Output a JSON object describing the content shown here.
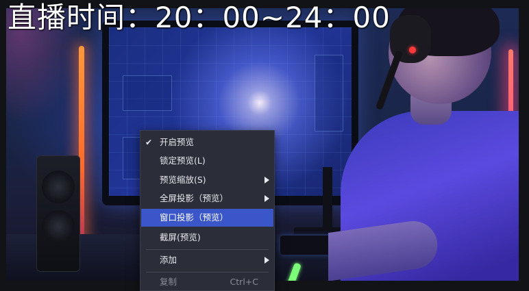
{
  "overlay": {
    "title": "直播时间：20：00~24：00"
  },
  "context_menu": {
    "items": [
      {
        "label": "开启预览",
        "checked": true
      },
      {
        "label": "锁定预览(L)"
      },
      {
        "label": "预览缩放(S)",
        "submenu": true
      },
      {
        "label": "全屏投影（预览）",
        "submenu": true
      },
      {
        "label": "窗口投影（预览）",
        "highlighted": true
      },
      {
        "label": "截屏(预览)"
      },
      {
        "label": "添加",
        "submenu": true
      },
      {
        "label": "复制",
        "shortcut": "Ctrl+C",
        "disabled": true
      }
    ]
  },
  "icons": {
    "check": "✔"
  },
  "colors": {
    "menu_bg": "#2b2e38",
    "highlight": "#3a56c8",
    "text": "#e8e9ee",
    "disabled_text": "#8a8d98"
  }
}
